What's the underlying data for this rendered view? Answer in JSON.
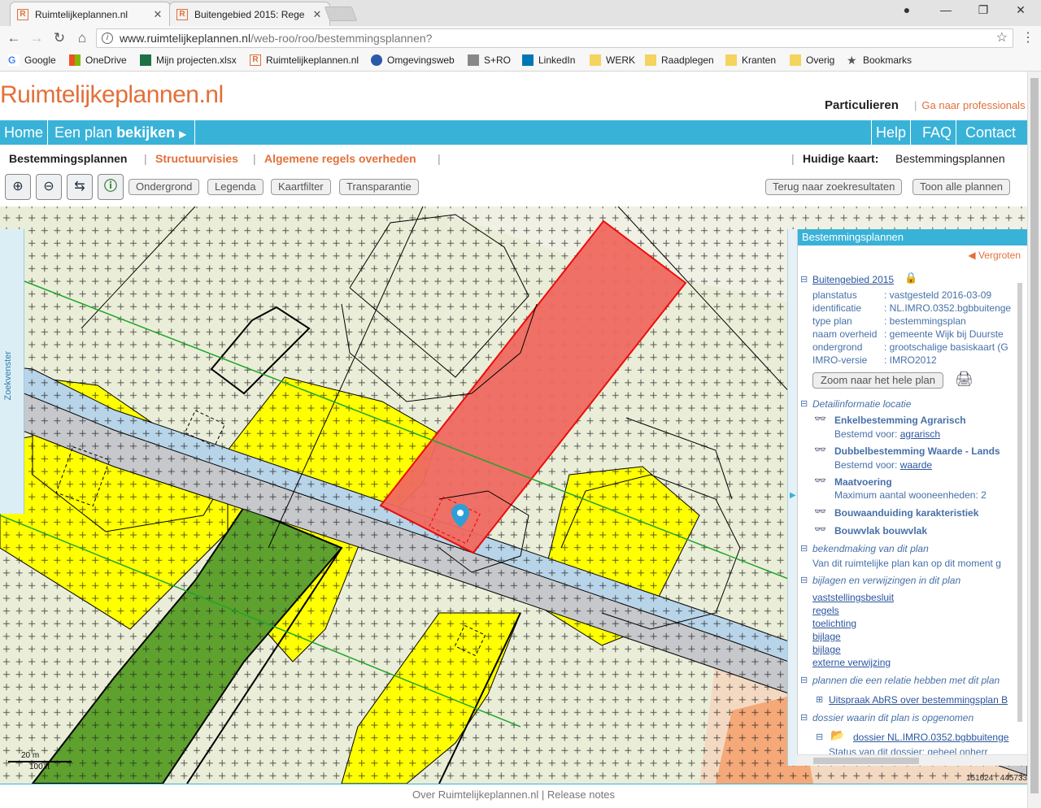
{
  "browser": {
    "tabs": [
      {
        "title": "Ruimtelijkeplannen.nl",
        "favicon": "R"
      },
      {
        "title": "Buitengebied 2015: Rege",
        "favicon": "R"
      }
    ],
    "url_host": "www.ruimtelijkeplannen.nl",
    "url_path": "/web-roo/roo/bestemmingsplannen?",
    "bookmarks": [
      "Google",
      "OneDrive",
      "Mijn projecten.xlsx",
      "Ruimtelijkeplannen.nl",
      "Omgevingsweb",
      "S+RO",
      "LinkedIn",
      "WERK",
      "Raadplegen",
      "Kranten",
      "Overig",
      "Bookmarks"
    ]
  },
  "site": {
    "logo": "Ruimtelijkeplannen.nl",
    "particulieren": "Particulieren",
    "professionals": "Ga naar professionals",
    "nav": {
      "home": "Home",
      "plan_prefix": "Een plan ",
      "plan_bold": "bekijken",
      "help": "Help",
      "faq": "FAQ",
      "contact": "Contact"
    },
    "subnav": {
      "bestemmingsplannen": "Bestemmingsplannen",
      "structuurvisies": "Structuurvisies",
      "algemene": "Algemene regels overheden",
      "huidige_label": "Huidige kaart:",
      "huidige_value": "Bestemmingsplannen"
    },
    "toolbar": {
      "ondergrond": "Ondergrond",
      "legenda": "Legenda",
      "kaartfilter": "Kaartfilter",
      "transparantie": "Transparantie",
      "terug": "Terug naar zoekresultaten",
      "toon": "Toon alle plannen"
    },
    "footer": "Over Ruimtelijkeplannen.nl | Release notes"
  },
  "map": {
    "zoekvenster": "Zoekvenster",
    "scale_top": "20 m",
    "scale_bottom": "100 ft",
    "coord": "151624 : 445733"
  },
  "panel": {
    "title": "Bestemmingsplannen",
    "vergroten": "Vergroten",
    "plan_name": "Buitengebied 2015",
    "props": [
      {
        "k": "planstatus",
        "v": ": vastgesteld 2016-03-09"
      },
      {
        "k": "identificatie",
        "v": ": NL.IMRO.0352.bgbbuitenge"
      },
      {
        "k": "type plan",
        "v": ": bestemmingsplan"
      },
      {
        "k": "naam overheid",
        "v": ": gemeente Wijk bij Duurste"
      },
      {
        "k": "ondergrond",
        "v": ": grootschalige basiskaart (G"
      },
      {
        "k": "IMRO-versie",
        "v": ": IMRO2012"
      }
    ],
    "zoom_btn": "Zoom naar het hele plan",
    "detail_head": "Detailinformatie locatie",
    "enkel": "Enkelbestemming Agrarisch",
    "enkel_sub": "Bestemd voor:",
    "enkel_link": "agrarisch",
    "dubbel": "Dubbelbestemming Waarde - Lands",
    "dubbel_sub": "Bestemd voor:",
    "dubbel_link": "waarde",
    "maat": "Maatvoering",
    "maat_sub": "Maximum aantal wooneenheden: 2",
    "bouwaand": "Bouwaanduiding karakteristiek",
    "bouwvlak": "Bouwvlak bouwvlak",
    "bekend_head": "bekendmaking van dit plan",
    "bekend_text": "Van dit ruimtelijke plan kan op dit moment g",
    "bijlagen_head": "bijlagen en verwijzingen in dit plan",
    "bijlagen": [
      "vaststellingsbesluit",
      "regels",
      "toelichting",
      "bijlage",
      "bijlage",
      "externe verwijzing"
    ],
    "relatie_head": "plannen die een relatie hebben met dit plan",
    "relatie_link": "Uitspraak AbRS over bestemmingsplan B",
    "dossier_head": "dossier waarin dit plan is opgenomen",
    "dossier_link": "dossier NL.IMRO.0352.bgbbuitenge",
    "dossier_sub": "Status van dit dossier: geheel onherr"
  }
}
